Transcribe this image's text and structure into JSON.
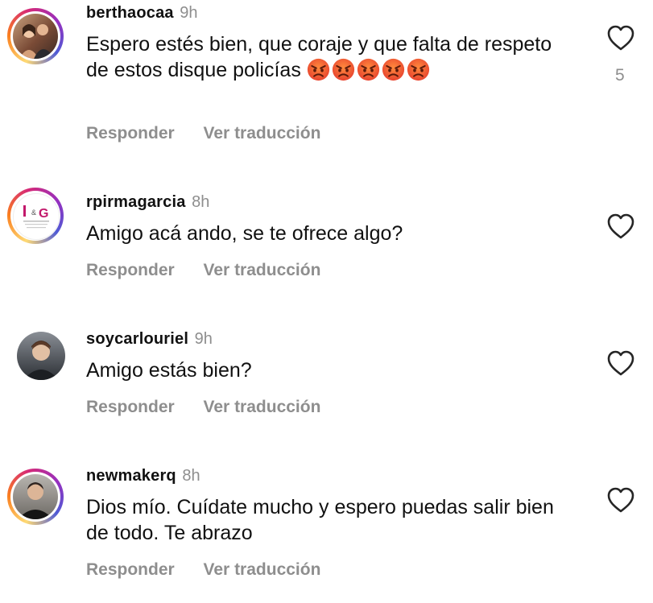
{
  "comments": [
    {
      "username": "berthaocaa",
      "time": "9h",
      "text": "Espero estés bien, que coraje y que falta de respeto de estos disque policías",
      "emojis": [
        "angry-face-emoji",
        "angry-face-emoji",
        "angry-face-emoji",
        "angry-face-emoji",
        "angry-face-emoji"
      ],
      "likes": "5",
      "reply_label": "Responder",
      "translate_label": "Ver traducción"
    },
    {
      "username": "rpirmagarcia",
      "time": "8h",
      "text": "Amigo acá ando, se te ofrece algo?",
      "avatar_logo": "I & G",
      "reply_label": "Responder",
      "translate_label": "Ver traducción"
    },
    {
      "username": "soycarlouriel",
      "time": "9h",
      "text": "Amigo estás bien?",
      "reply_label": "Responder",
      "translate_label": "Ver traducción"
    },
    {
      "username": "newmakerq",
      "time": "8h",
      "text": "Dios mío. Cuídate mucho y espero puedas salir bien de  todo. Te abrazo",
      "reply_label": "Responder",
      "translate_label": "Ver traducción"
    }
  ],
  "colors": {
    "muted": "#8e8e8e",
    "text": "#111111",
    "emoji_face": "#e8442f"
  }
}
